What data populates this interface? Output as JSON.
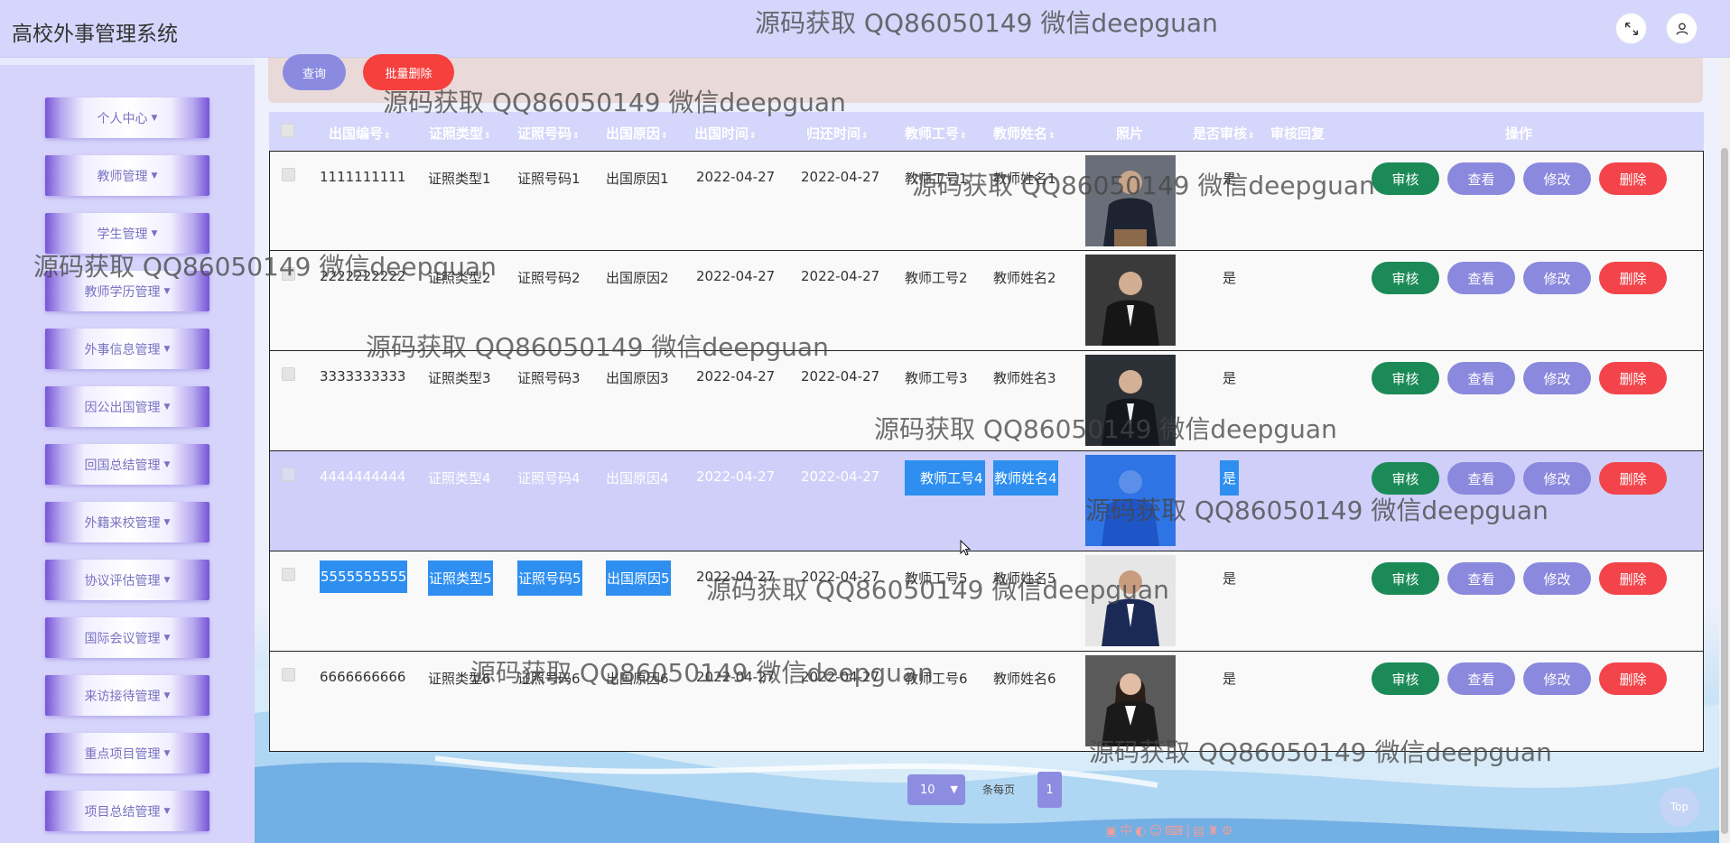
{
  "app": {
    "title": "高校外事管理系统"
  },
  "header": {
    "fullscreen_icon": "expand-icon",
    "user_icon": "user-icon"
  },
  "sidebar": {
    "items": [
      {
        "label": "个人中心"
      },
      {
        "label": "教师管理"
      },
      {
        "label": "学生管理"
      },
      {
        "label": "教师学历管理"
      },
      {
        "label": "外事信息管理"
      },
      {
        "label": "因公出国管理"
      },
      {
        "label": "回国总结管理"
      },
      {
        "label": "外籍来校管理"
      },
      {
        "label": "协议评估管理"
      },
      {
        "label": "国际会议管理"
      },
      {
        "label": "来访接待管理"
      },
      {
        "label": "重点项目管理"
      },
      {
        "label": "项目总结管理"
      }
    ]
  },
  "toolbar": {
    "query_label": "查询",
    "batch_delete_label": "批量删除"
  },
  "table": {
    "headers": {
      "out_no": "出国编号",
      "cert_type": "证照类型",
      "cert_no": "证照号码",
      "reason": "出国原因",
      "out_time": "出国时间",
      "return_time": "归还时间",
      "teacher_id": "教师工号",
      "teacher_name": "教师姓名",
      "photo": "照片",
      "audited": "是否审核",
      "audit_reply": "审核回复",
      "actions": "操作"
    },
    "actions": {
      "audit": "审核",
      "view": "查看",
      "edit": "修改",
      "delete": "删除"
    },
    "rows": [
      {
        "out_no": "1111111111",
        "cert_type": "证照类型1",
        "cert_no": "证照号码1",
        "reason": "出国原因1",
        "out_time": "2022-04-27",
        "return_time": "2022-04-27",
        "teacher_id": "教师工号1",
        "teacher_name": "教师姓名1",
        "audited": "是",
        "audit_reply": ""
      },
      {
        "out_no": "2222222222",
        "cert_type": "证照类型2",
        "cert_no": "证照号码2",
        "reason": "出国原因2",
        "out_time": "2022-04-27",
        "return_time": "2022-04-27",
        "teacher_id": "教师工号2",
        "teacher_name": "教师姓名2",
        "audited": "是",
        "audit_reply": ""
      },
      {
        "out_no": "3333333333",
        "cert_type": "证照类型3",
        "cert_no": "证照号码3",
        "reason": "出国原因3",
        "out_time": "2022-04-27",
        "return_time": "2022-04-27",
        "teacher_id": "教师工号3",
        "teacher_name": "教师姓名3",
        "audited": "是",
        "audit_reply": ""
      },
      {
        "out_no": "4444444444",
        "cert_type": "证照类型4",
        "cert_no": "证照号码4",
        "reason": "出国原因4",
        "out_time": "2022-04-27",
        "return_time": "2022-04-27",
        "teacher_id": "教师工号4",
        "teacher_name": "教师姓名4",
        "audited": "是",
        "audit_reply": ""
      },
      {
        "out_no": "5555555555",
        "cert_type": "证照类型5",
        "cert_no": "证照号码5",
        "reason": "出国原因5",
        "out_time": "2022-04-27",
        "return_time": "2022-04-27",
        "teacher_id": "教师工号5",
        "teacher_name": "教师姓名5",
        "audited": "是",
        "audit_reply": ""
      },
      {
        "out_no": "6666666666",
        "cert_type": "证照类型6",
        "cert_no": "证照号码6",
        "reason": "出国原因6",
        "out_time": "2022-04-27",
        "return_time": "2022-04-27",
        "teacher_id": "教师工号6",
        "teacher_name": "教师姓名6",
        "audited": "是",
        "audit_reply": ""
      }
    ]
  },
  "pagination": {
    "page_size": "10",
    "per_page_label": "条每页",
    "current_page": "1",
    "top_label": "Top"
  },
  "watermark": "源码获取 QQ86050149 微信deepguan",
  "colors": {
    "header_bg": "#d5d6fb",
    "accent": "#8a8be0",
    "danger": "#f5403e",
    "success": "#1b8a57",
    "selection": "#2e8ff0"
  }
}
